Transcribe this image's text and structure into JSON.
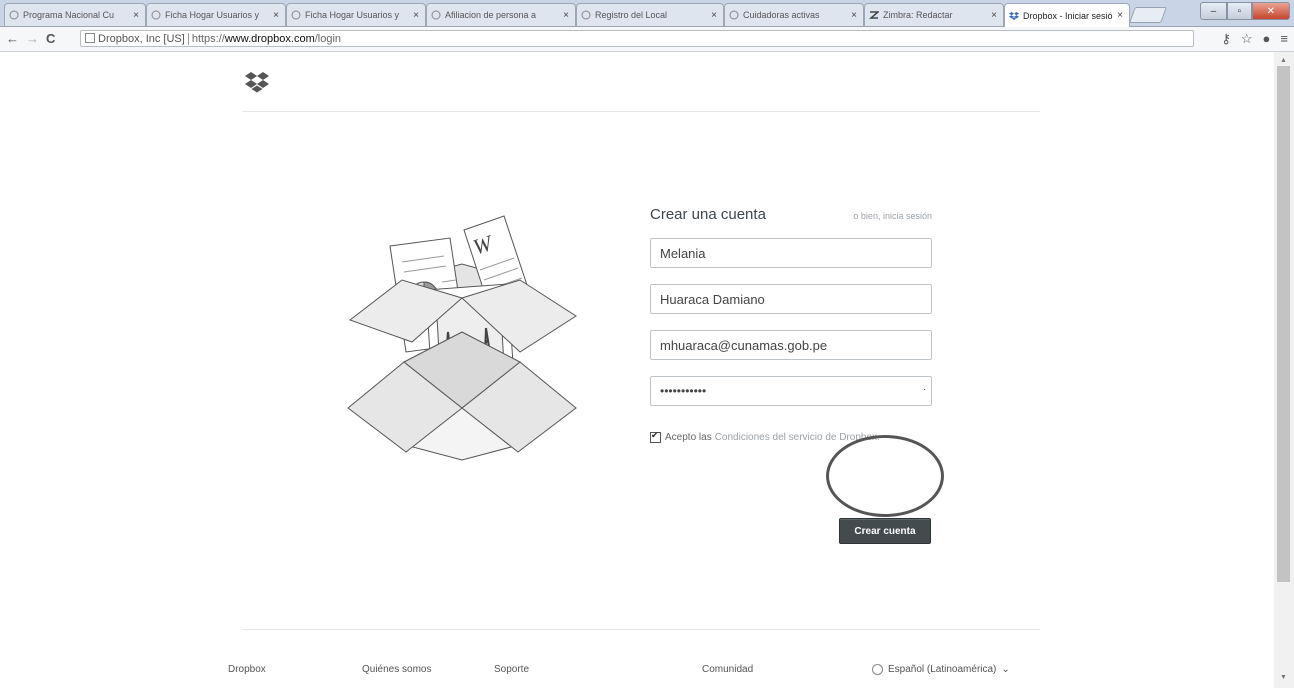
{
  "tabs": [
    {
      "title": "Programa Nacional Cu",
      "favicon": "page-icon",
      "active": false
    },
    {
      "title": "Ficha Hogar Usuarios y",
      "favicon": "page-icon",
      "active": false
    },
    {
      "title": "Ficha Hogar Usuarios y",
      "favicon": "page-icon",
      "active": false
    },
    {
      "title": "Afiliacion de persona a",
      "favicon": "page-icon",
      "active": false
    },
    {
      "title": "Registro del Local",
      "favicon": "page-icon",
      "active": false
    },
    {
      "title": "Cuidadoras activas",
      "favicon": "page-icon",
      "active": false
    },
    {
      "title": "Zimbra: Redactar",
      "favicon": "zimbra-icon",
      "active": false
    },
    {
      "title": "Dropbox - Iniciar sesión",
      "favicon": "dropbox-icon",
      "active": true
    }
  ],
  "tab_close_glyph": "×",
  "omnibox": {
    "secure_label": "Dropbox, Inc [US]",
    "url_proto": "https://",
    "url_host": "www.dropbox.com",
    "url_path": "/login"
  },
  "form": {
    "title": "Crear una cuenta",
    "alt_prefix": "o bien,",
    "alt_link": "inicia sesión",
    "first_name": "Melania",
    "last_name": "Huaraca Damiano",
    "email": "mhuaraca@cunamas.gob.pe",
    "password": "•••••••••••",
    "tos_prefix": "Acepto las",
    "tos_link": "Condiciones del servicio de Dropbox.",
    "tos_checked": true,
    "submit_label": "Crear cuenta"
  },
  "footer": {
    "links": [
      "Dropbox",
      "Quiénes somos",
      "Soporte",
      "Comunidad"
    ],
    "language": "Español (Latinoamérica)",
    "language_caret": "⌄"
  },
  "colors": {
    "submit_bg": "#444b4f",
    "accent_text": "#3d464d",
    "link_gray": "#9aa2a8"
  }
}
